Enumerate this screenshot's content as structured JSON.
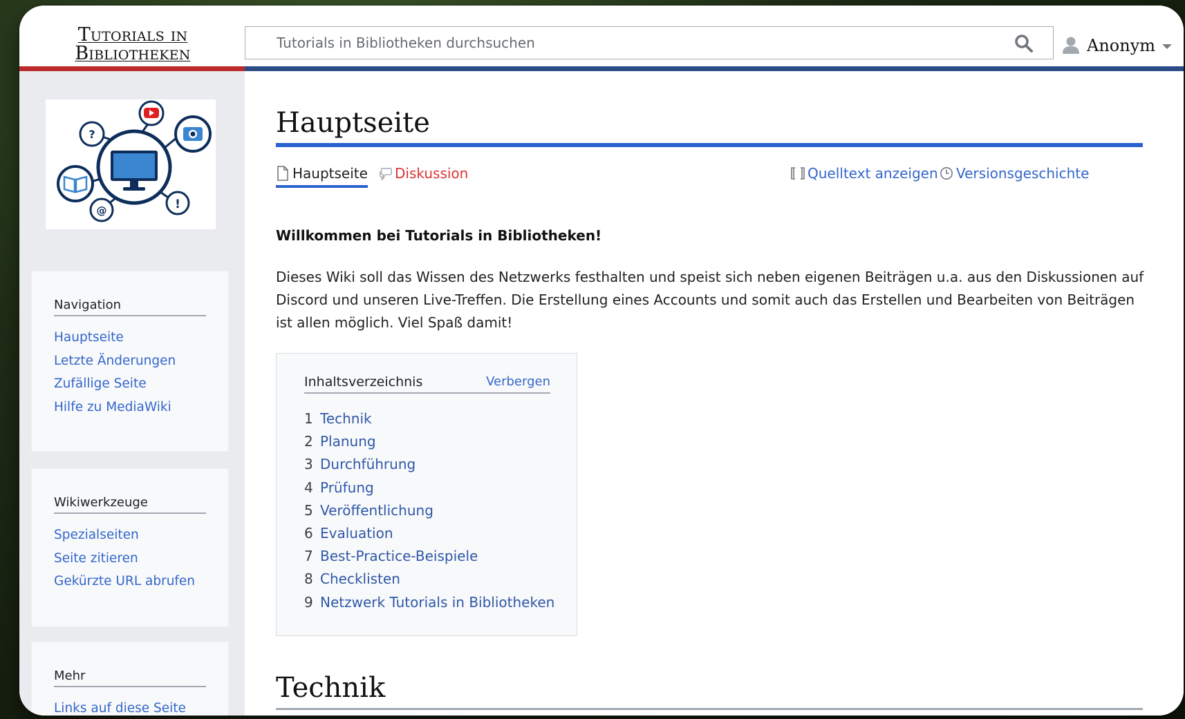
{
  "header": {
    "logo_line1": "Tutorials in",
    "logo_line2": "Bibliotheken",
    "search_placeholder": "Tutorials in Bibliotheken durchsuchen",
    "user_name": "Anonym"
  },
  "sidebar": {
    "portlets": [
      {
        "heading": "Navigation",
        "items": [
          "Hauptseite",
          "Letzte Änderungen",
          "Zufällige Seite",
          "Hilfe zu MediaWiki"
        ]
      },
      {
        "heading": "Wikiwerkzeuge",
        "items": [
          "Spezialseiten",
          "Seite zitieren",
          "Gekürzte URL abrufen"
        ]
      },
      {
        "heading": "Mehr",
        "items": [
          "Links auf diese Seite"
        ]
      }
    ]
  },
  "content": {
    "title": "Hauptseite",
    "tabs": {
      "page": "Hauptseite",
      "talk": "Diskussion",
      "source": "Quelltext anzeigen",
      "history": "Versionsgeschichte"
    },
    "intro_bold": "Willkommen bei Tutorials in Bibliotheken!",
    "intro_text": "Dieses Wiki soll das Wissen des Netzwerks festhalten und speist sich neben eigenen Beiträgen u.a. aus den Diskussionen auf Discord und unseren Live-Treffen. Die Erstellung eines Accounts und somit auch das Erstellen und Bearbeiten von Beiträgen ist allen möglich. Viel Spaß damit!",
    "toc": {
      "title": "Inhaltsverzeichnis",
      "toggle": "Verbergen",
      "items": [
        {
          "num": "1",
          "label": "Technik"
        },
        {
          "num": "2",
          "label": "Planung"
        },
        {
          "num": "3",
          "label": "Durchführung"
        },
        {
          "num": "4",
          "label": "Prüfung"
        },
        {
          "num": "5",
          "label": "Veröffentlichung"
        },
        {
          "num": "6",
          "label": "Evaluation"
        },
        {
          "num": "7",
          "label": "Best-Practice-Beispiele"
        },
        {
          "num": "8",
          "label": "Checklisten"
        },
        {
          "num": "9",
          "label": "Netzwerk Tutorials in Bibliotheken"
        }
      ]
    },
    "section_heading": "Technik"
  },
  "colors": {
    "accent_blue": "#2a63cf",
    "stripe_red": "#bc2b2b",
    "stripe_navy": "#2c4c86",
    "link": "#3366cc",
    "new_link": "#dd3333"
  },
  "icons": {
    "search": "search-icon",
    "user": "user-icon",
    "page": "page-icon",
    "talk": "speech-bubble-icon",
    "source": "wikitext-icon",
    "history": "clock-icon",
    "logo": "network-computer-logo"
  }
}
